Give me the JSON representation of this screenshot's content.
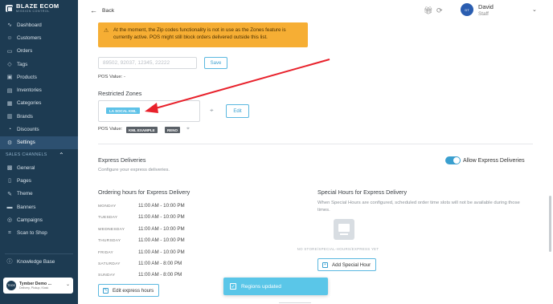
{
  "brand": {
    "name": "BLAZE ECOM",
    "subtitle": "MISSION CONTROL"
  },
  "sidebar": {
    "items": [
      {
        "label": "Dashboard",
        "icon": "dashboard-icon",
        "glyph": "∿"
      },
      {
        "label": "Customers",
        "icon": "customers-icon",
        "glyph": "☺"
      },
      {
        "label": "Orders",
        "icon": "orders-icon",
        "glyph": "▭"
      },
      {
        "label": "Tags",
        "icon": "tag-icon",
        "glyph": "◇"
      },
      {
        "label": "Products",
        "icon": "products-icon",
        "glyph": "▣"
      },
      {
        "label": "Inventories",
        "icon": "inventory-icon",
        "glyph": "▤"
      },
      {
        "label": "Categories",
        "icon": "categories-icon",
        "glyph": "▦"
      },
      {
        "label": "Brands",
        "icon": "brands-icon",
        "glyph": "▥"
      },
      {
        "label": "Discounts",
        "icon": "discount-icon",
        "glyph": "◔"
      },
      {
        "label": "Settings",
        "icon": "gear-icon",
        "glyph": "⚙",
        "active": true
      }
    ],
    "section_label": "SALES CHANNELS",
    "channel_items": [
      {
        "label": "General",
        "icon": "general-icon",
        "glyph": "▩"
      },
      {
        "label": "Pages",
        "icon": "pages-icon",
        "glyph": "▯"
      },
      {
        "label": "Theme",
        "icon": "theme-icon",
        "glyph": "✎"
      },
      {
        "label": "Banners",
        "icon": "banners-icon",
        "glyph": "▬"
      },
      {
        "label": "Campaigns",
        "icon": "campaigns-icon",
        "glyph": "◎"
      },
      {
        "label": "Scan to Shop",
        "icon": "scan-icon",
        "glyph": "⌗"
      }
    ],
    "knowledge_base": {
      "label": "Knowledge Base",
      "glyph": "ⓘ"
    },
    "store": {
      "initials": "TDOS",
      "name": "Tymber Demo ...",
      "subtitle": "Delivery, Pickup, Kiosk"
    }
  },
  "topbar": {
    "back_label": "Back",
    "user_initials": "DT",
    "user_name": "David",
    "user_role": "Staff"
  },
  "warning": {
    "text": "At the moment, the Zip codes functionality is not in use as the Zones feature is currently active. POS might still block orders delivered outside this list."
  },
  "zip": {
    "placeholder": "89502, 92037, 12345, 22222",
    "save_label": "Save",
    "pos_value_label": "POS Value: -"
  },
  "zones": {
    "title": "Restricted Zones",
    "chip": "LA SOCAL KML",
    "edit_label": "Edit",
    "pos_value_label": "POS Value:",
    "pos_chips": [
      "KML EXAMPLE",
      "RENO"
    ]
  },
  "express": {
    "title": "Express Deliveries",
    "description": "Configure your express deliveries.",
    "toggle_label": "Allow Express Deliveries",
    "toggle_on": true,
    "hours_title": "Ordering hours for Express Delivery",
    "hours": [
      {
        "day": "MONDAY",
        "time": "11:00 AM - 10:00 PM"
      },
      {
        "day": "TUESDAY",
        "time": "11:00 AM - 10:00 PM"
      },
      {
        "day": "WEDNESDAY",
        "time": "11:00 AM - 10:00 PM"
      },
      {
        "day": "THURSDAY",
        "time": "11:00 AM - 10:00 PM"
      },
      {
        "day": "FRIDAY",
        "time": "11:00 AM - 10:00 PM"
      },
      {
        "day": "SATURDAY",
        "time": "11:00 AM - 8:00 PM"
      },
      {
        "day": "SUNDAY",
        "time": "11:00 AM - 8:00 PM"
      }
    ],
    "edit_hours_label": "Edit express hours",
    "special_title": "Special Hours for Express Delivery",
    "special_desc": "When Special Hours are configured, scheduled order time slots will not be available during those times.",
    "empty_text": "NO STORE/SPECIAL-HOURS/EXPRESS YET",
    "add_special_label": "Add Special Hour"
  },
  "toast": {
    "text": "Regions updated"
  },
  "colors": {
    "sidebar_bg": "#1d3b52",
    "accent": "#3a9fcf",
    "warning_bg": "#f6ae34",
    "annotation_arrow": "#e8212b"
  }
}
